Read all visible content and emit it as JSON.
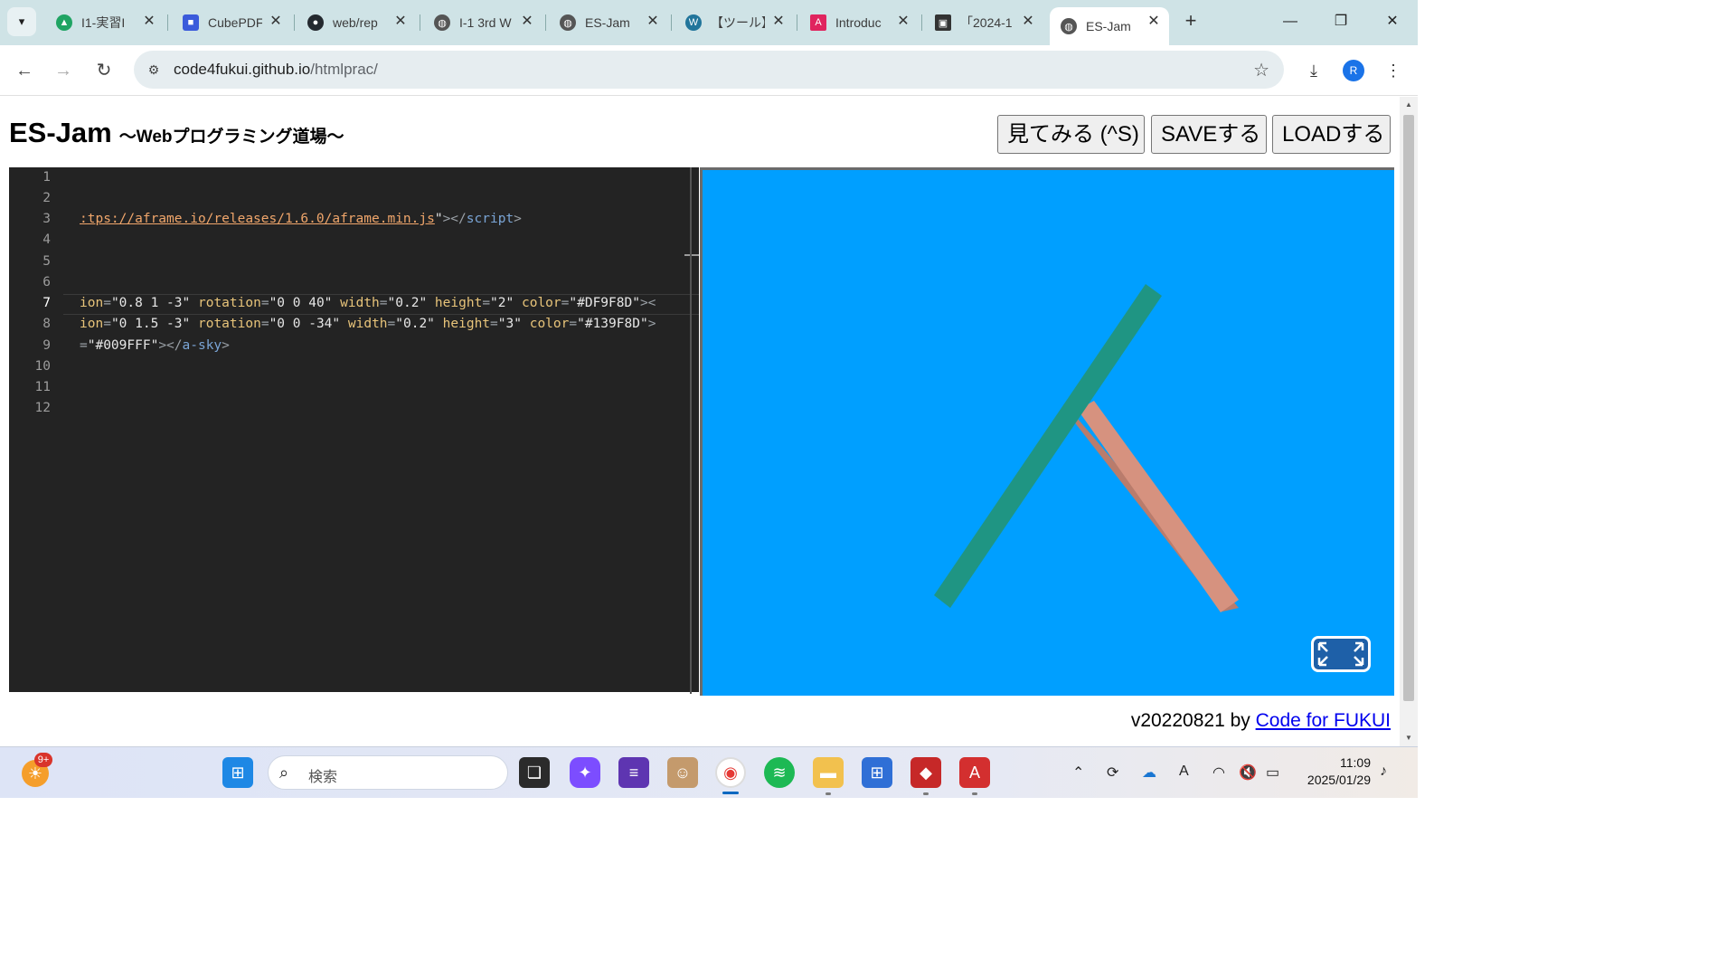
{
  "browser": {
    "tabs": [
      {
        "title": "I1-実習I",
        "icon": "google-drive-icon",
        "color": "#1fa463"
      },
      {
        "title": "CubePDF",
        "icon": "cube-icon",
        "color": "#3b5bdb"
      },
      {
        "title": "web/rep",
        "icon": "github-icon",
        "color": "#24292f"
      },
      {
        "title": "I-1 3rd W",
        "icon": "globe-icon",
        "color": "#555555"
      },
      {
        "title": "ES-Jam",
        "icon": "globe-icon",
        "color": "#555555"
      },
      {
        "title": "【ツール】",
        "icon": "wordpress-icon",
        "color": "#21759b"
      },
      {
        "title": "Introduc",
        "icon": "acrobat-icon",
        "color": "#e0245e"
      },
      {
        "title": "「2024-1",
        "icon": "contact-card-icon",
        "color": "#333333"
      },
      {
        "title": "ES-Jam",
        "icon": "globe-icon",
        "color": "#555555"
      }
    ],
    "address": {
      "host": "code4fukui.github.io",
      "path": "/htmlprac/"
    },
    "profile_initial": "R"
  },
  "app": {
    "title": "ES-Jam",
    "subtitle": "～Webプログラミング道場～",
    "buttons": {
      "preview": "見てみる (^S)",
      "save": "SAVEする",
      "load": "LOADする"
    },
    "footer_version": "v20220821 by ",
    "footer_link": "Code for FUKUI"
  },
  "editor": {
    "line_numbers": [
      "1",
      "2",
      "3",
      "4",
      "5",
      "6",
      "7",
      "8",
      "9",
      "10",
      "11",
      "12"
    ],
    "current_line": 7,
    "lines": {
      "l3": {
        "url": ":tps://aframe.io/releases/1.6.0/aframe.min.js",
        "q": "\"",
        "close": "></",
        "tag": "script",
        "end": ">"
      },
      "l7": {
        "a1": "ion",
        "v1": "\"0.8 1 -3\"",
        "a2": "rotation",
        "v2": "\"0 0 40\"",
        "a3": "width",
        "v3": "\"0.2\"",
        "a4": "height",
        "v4": "\"2\"",
        "a5": "color",
        "v5": "\"#DF9F8D\"",
        "end": "><"
      },
      "l8": {
        "a1": "ion",
        "v1": "\"0 1.5 -3\"",
        "a2": "rotation",
        "v2": "\"0 0 -34\"",
        "a3": "width",
        "v3": "\"0.2\"",
        "a4": "height",
        "v4": "\"3\"",
        "a5": "color",
        "v5": "\"#139F8D\"",
        "end": ">"
      },
      "l9": {
        "a1": "=",
        "v1": "\"#009FFF\"",
        "close": "></",
        "tag": "a-sky",
        "end": ">"
      }
    }
  },
  "scene": {
    "sky_color": "#009FFF",
    "boxes": [
      {
        "color": "#DF9F8D",
        "rotation_deg": 40
      },
      {
        "color": "#139F8D",
        "rotation_deg": -34
      }
    ]
  },
  "taskbar": {
    "weather_badge": "9+",
    "search_placeholder": "検索",
    "time": "11:09",
    "date": "2025/01/29"
  }
}
